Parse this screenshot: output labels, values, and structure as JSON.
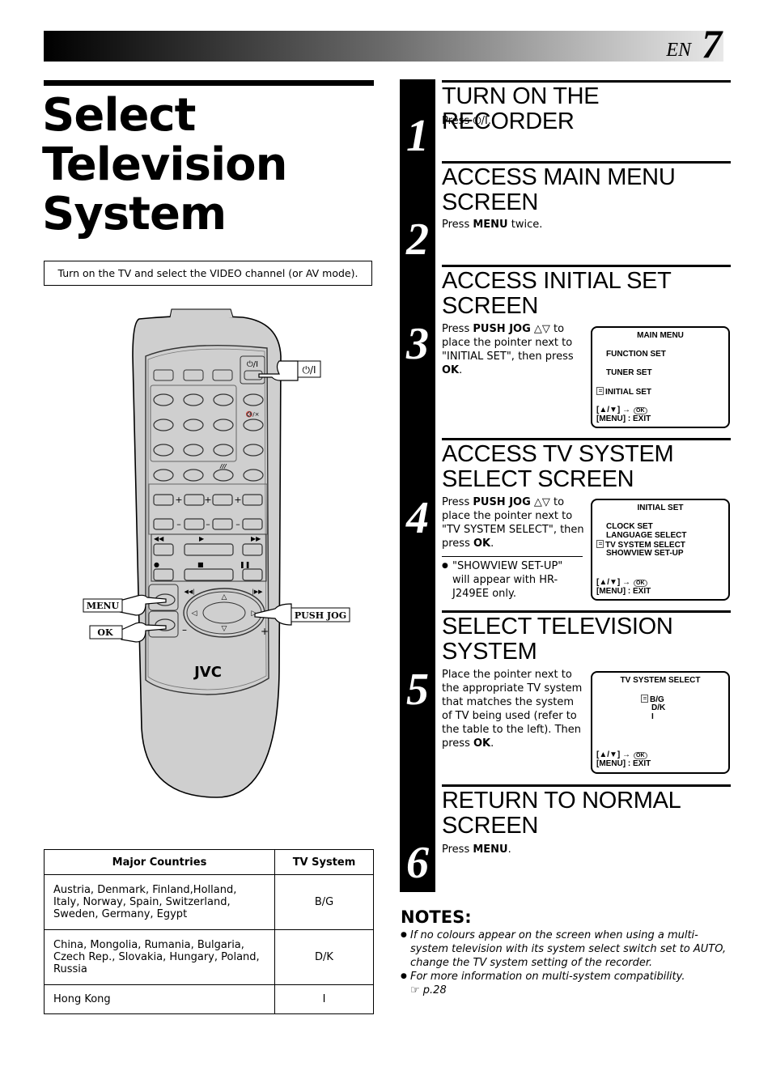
{
  "header": {
    "lang_code": "EN",
    "page_number": "7"
  },
  "title": {
    "line1": "Select",
    "line2": "Television",
    "line3": "System"
  },
  "intro": "Turn on the TV and select the VIDEO channel (or AV mode).",
  "remote": {
    "brand": "JVC",
    "callouts": {
      "power": "⏻/I",
      "menu": "MENU",
      "ok": "OK",
      "push_jog": "PUSH JOG"
    },
    "small_labels": {
      "power_key": "⏻/I",
      "mute": "🔇/×",
      "slash": "///"
    }
  },
  "table": {
    "headers": [
      "Major Countries",
      "TV System"
    ],
    "rows": [
      {
        "countries": "Austria, Denmark, Finland,Holland, Italy, Norway, Spain, Switzerland, Sweden, Germany, Egypt",
        "system": "B/G"
      },
      {
        "countries": "China, Mongolia, Rumania, Bulgaria, Czech Rep., Slovakia, Hungary, Poland, Russia",
        "system": "D/K"
      },
      {
        "countries": "Hong Kong",
        "system": "I"
      }
    ]
  },
  "steps": [
    {
      "number": "1",
      "title": "TURN ON THE RECORDER",
      "text_pre": "Press ",
      "text_key": "⏻/I",
      "text_post": "."
    },
    {
      "number": "2",
      "title_line1": "ACCESS MAIN MENU",
      "title_line2": "SCREEN",
      "text_pre": "Press ",
      "text_bold": "MENU",
      "text_post": " twice."
    },
    {
      "number": "3",
      "title_line1": "ACCESS INITIAL SET",
      "title_line2": "SCREEN",
      "text": [
        "Press ",
        "PUSH JOG",
        " △▽ to place the pointer next to \"INITIAL SET\", then press ",
        "OK",
        "."
      ],
      "osd": {
        "title": "MAIN MENU",
        "items": [
          "FUNCTION SET",
          "TUNER SET",
          "INITIAL SET"
        ],
        "selected": "INITIAL SET",
        "nav": "[▲/▼] →",
        "ok": "OK",
        "exit": "[MENU] : EXIT"
      }
    },
    {
      "number": "4",
      "title_line1": "ACCESS TV SYSTEM",
      "title_line2": "SELECT SCREEN",
      "text": [
        "Press ",
        "PUSH JOG",
        " △▽ to place the pointer next to \"TV SYSTEM SELECT\", then press ",
        "OK",
        "."
      ],
      "note": "\"SHOWVIEW SET-UP\" will appear with HR-J249EE only.",
      "osd": {
        "title": "INITIAL SET",
        "items": [
          "CLOCK SET",
          "LANGUAGE SELECT",
          "TV SYSTEM SELECT",
          "SHOWVIEW SET-UP"
        ],
        "selected": "TV SYSTEM SELECT",
        "nav": "[▲/▼] →",
        "ok": "OK",
        "exit": "[MENU] : EXIT"
      }
    },
    {
      "number": "5",
      "title_line1": "SELECT TELEVISION",
      "title_line2": "SYSTEM",
      "text": [
        "Place the pointer next to the appropriate TV system that matches the system of TV being used (refer to the table to the left). Then press ",
        "OK",
        "."
      ],
      "osd": {
        "title": "TV SYSTEM SELECT",
        "items": [
          "B/G",
          "D/K",
          "I"
        ],
        "selected": "B/G",
        "nav": "[▲/▼] →",
        "ok": "OK",
        "exit": "[MENU] : EXIT"
      }
    },
    {
      "number": "6",
      "title_line1": "RETURN TO NORMAL",
      "title_line2": "SCREEN",
      "text_pre": "Press ",
      "text_bold": "MENU",
      "text_post": "."
    }
  ],
  "notes": {
    "title": "NOTES:",
    "items": [
      "If no colours appear on the screen when using a multi-system television with its system select switch set to AUTO, change the TV system setting of the recorder.",
      "For more information on multi-system compatibility."
    ],
    "ref_icon": "☞",
    "ref_page": " p.28"
  }
}
